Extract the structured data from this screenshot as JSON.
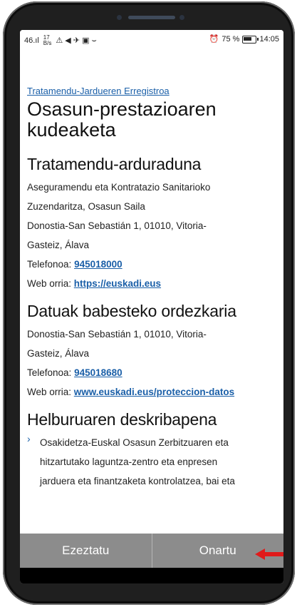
{
  "status_bar": {
    "signal": "46.ıl",
    "speed": "17\nB/s",
    "icons_left": "⚠ ◀ ✈ ▣ ⌣",
    "alarm": "⏰",
    "battery_percent": "75 %",
    "battery_level": 0.75,
    "time": "14:05"
  },
  "breadcrumb": "Tratamendu-Jardueren Erregistroa",
  "page_title": "Osasun-prestazioaren kudeaketa",
  "controller": {
    "heading": "Tratamendu-arduraduna",
    "line1": "Aseguramendu eta Kontratazio Sanitarioko",
    "line2": "Zuzendaritza, Osasun Saila",
    "line3": "Donostia-San Sebastián 1, 01010, Vitoria-",
    "line4": "Gasteiz, Álava",
    "phone_label": "Telefonoa: ",
    "phone": "945018000",
    "web_label": "Web orria: ",
    "web": "https://euskadi.eus"
  },
  "dpo": {
    "heading": "Datuak babesteko ordezkaria",
    "line1": "Donostia-San Sebastián 1, 01010, Vitoria-",
    "line2": "Gasteiz, Álava",
    "phone_label": "Telefonoa: ",
    "phone": "945018680",
    "web_label": "Web orria: ",
    "web": "www.euskadi.eus/proteccion-datos"
  },
  "purpose": {
    "heading": "Helburuaren deskribapena",
    "item1_line1": "Osakidetza-Euskal Osasun Zerbitzuaren eta",
    "item1_line2": "hitzartutako laguntza-zentro eta enpresen",
    "item1_line3": "jarduera eta finantzaketa kontrolatzea, bai eta"
  },
  "buttons": {
    "cancel": "Ezeztatu",
    "accept": "Onartu"
  },
  "colors": {
    "link": "#1a5fa8",
    "button_bar": "#8c8c8c",
    "annotation_arrow": "#e01b1b"
  }
}
